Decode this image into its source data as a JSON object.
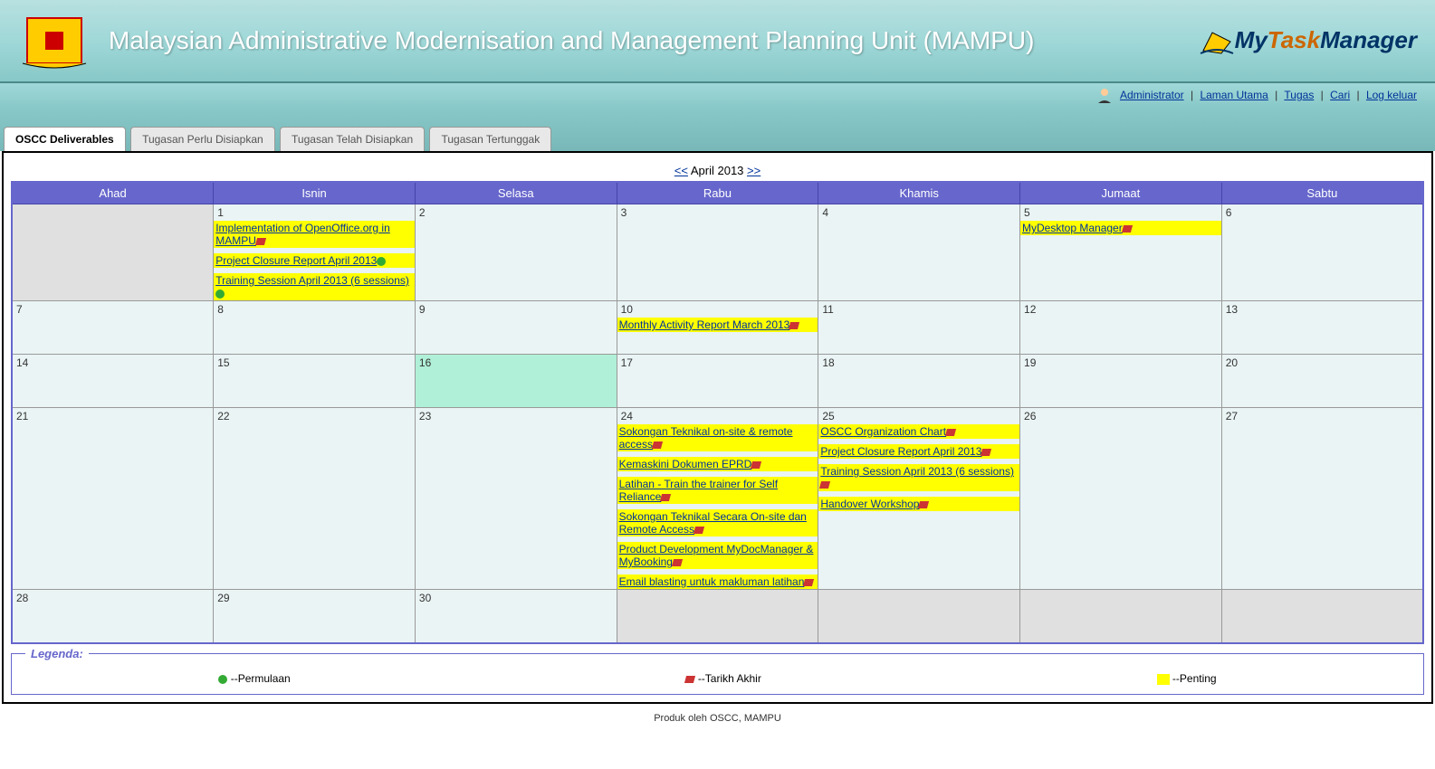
{
  "header": {
    "org_title": "Malaysian Administrative Modernisation and Management Planning Unit (MAMPU)",
    "logo_my": "My",
    "logo_task": "Task",
    "logo_manager": "Manager"
  },
  "userbar": {
    "admin": "Administrator",
    "home": "Laman Utama",
    "tasks": "Tugas",
    "search": "Cari",
    "logout": "Log keluar"
  },
  "tabs": {
    "t0": "OSCC Deliverables",
    "t1": "Tugasan Perlu Disiapkan",
    "t2": "Tugasan Telah Disiapkan",
    "t3": "Tugasan Tertunggak"
  },
  "calendar": {
    "prev": "<<",
    "title": "April 2013",
    "next": ">>",
    "days": {
      "d0": "Ahad",
      "d1": "Isnin",
      "d2": "Selasa",
      "d3": "Rabu",
      "d4": "Khamis",
      "d5": "Jumaat",
      "d6": "Sabtu"
    }
  },
  "events": {
    "d1_e1": "Implementation of OpenOffice.org in MAMPU",
    "d1_e2": "Project Closure Report April 2013",
    "d1_e3": "Training Session April 2013 (6 sessions)",
    "d5_e1": "MyDesktop Manager",
    "d10_e1": "Monthly Activity Report March 2013",
    "d24_e1": "Sokongan Teknikal on-site & remote access",
    "d24_e2": "Kemaskini Dokumen EPRD",
    "d24_e3": "Latihan - Train the trainer for Self Reliance",
    "d24_e4": "Sokongan Teknikal Secara On-site dan Remote Access",
    "d24_e5": "Product Development MyDocManager & MyBooking",
    "d24_e6": "Email blasting untuk makluman latihan",
    "d25_e1": "OSCC Organization Chart",
    "d25_e2": "Project Closure Report April 2013",
    "d25_e3": "Training Session April 2013 (6 sessions)",
    "d25_e4": "Handover Workshop"
  },
  "legend": {
    "title": "Legenda:",
    "start": "--Permulaan",
    "end": "--Tarikh Akhir",
    "important": "--Penting"
  },
  "footer": "Produk oleh OSCC, MAMPU"
}
